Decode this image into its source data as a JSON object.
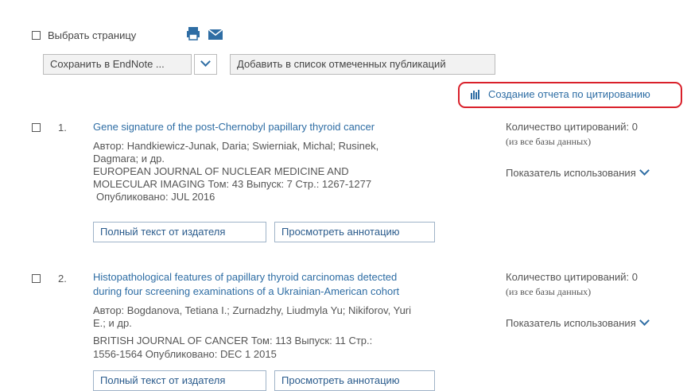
{
  "toolbar": {
    "select_page_label": "Выбрать страницу",
    "save_select_value": "Сохранить в EndNote ...",
    "add_to_marked_label": "Добавить в список отмеченных публикаций"
  },
  "citation_report_link": "Создание отчета по цитированию",
  "records": [
    {
      "number": "1.",
      "title": "Gene signature of the post-Chernobyl papillary thyroid cancer",
      "authors_line1": "Автор: Handkiewicz-Junak, Daria; Swierniak, Michal; Rusinek,",
      "authors_line2": "Dagmara; и др.",
      "source_line1": "EUROPEAN JOURNAL OF NUCLEAR MEDICINE AND",
      "source_line2": "MOLECULAR IMAGING  Том: 43   Выпуск: 7   Стр.: 1267-1277",
      "published": "Опубликовано: JUL 2016",
      "full_text_button": "Полный текст от издателя",
      "abstract_button": "Просмотреть аннотацию",
      "citations": "Количество цитирований: 0",
      "citations_source": "(из все базы данных)",
      "usage_label": "Показатель использования"
    },
    {
      "number": "2.",
      "title_line1": "Histopathological features of papillary thyroid carcinomas detected",
      "title_line2": "during four screening examinations of a Ukrainian-American cohort",
      "authors_line1": "Автор: Bogdanova, Tetiana I.; Zurnadzhy, Liudmyla Yu; Nikiforov, Yuri",
      "authors_line2": "E.; и др.",
      "source_line1": "BRITISH JOURNAL OF CANCER  Том: 113   Выпуск: 11   Стр.:",
      "source_line2": "1556-1564   Опубликовано: DEC 1 2015",
      "full_text_button": "Полный текст от издателя",
      "abstract_button": "Просмотреть аннотацию",
      "citations": "Количество цитирований: 0",
      "citations_source": "(из все базы данных)",
      "usage_label": "Показатель использования"
    }
  ],
  "colors": {
    "link": "#2e6da4",
    "highlight": "#d9202a",
    "text": "#555555"
  }
}
